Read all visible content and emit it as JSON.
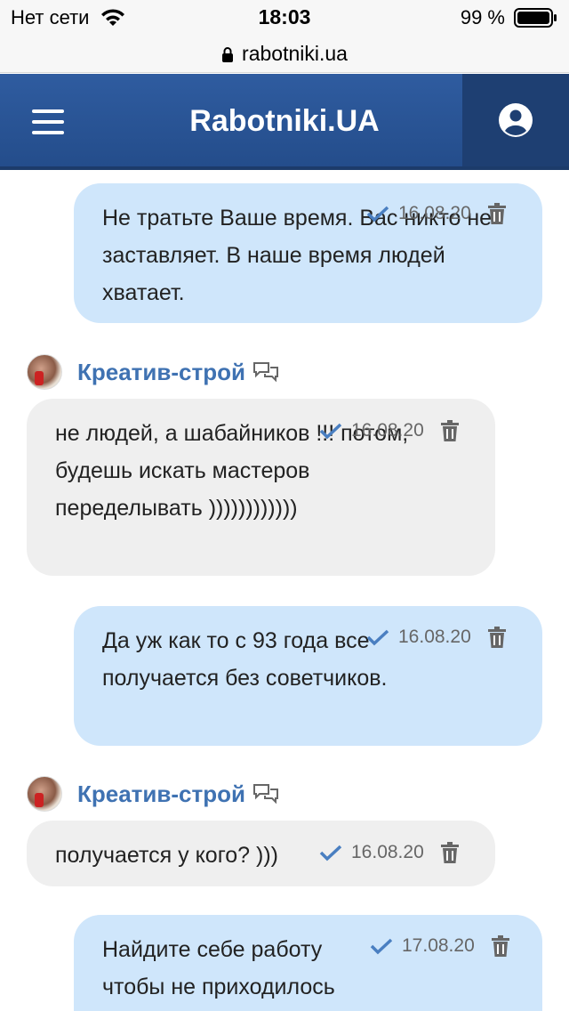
{
  "status_bar": {
    "carrier": "Нет сети",
    "time": "18:03",
    "battery": "99 %"
  },
  "browser": {
    "url": "rabotniki.ua"
  },
  "header": {
    "title": "Rabotniki.UA"
  },
  "colors": {
    "header_bg": "#2f5ca0",
    "my_bubble": "#cfe6fb",
    "their_bubble": "#efefef",
    "author_name": "#3f72b2",
    "check": "#4a7fc1"
  },
  "messages": [
    {
      "side": "mine",
      "text": "Не тратьте Ваше время. Вас никто не заставляет. В наше время людей хватает.",
      "date": "16.08.20"
    },
    {
      "side": "theirs",
      "author": "Креатив-строй",
      "text": "не людей, а шабайников !!! потом, будешь искать мастеров переделывать ))))))))))))",
      "date": "16.08.20"
    },
    {
      "side": "mine",
      "text": "Да уж как то с 93 года все получается без советчиков.",
      "date": "16.08.20"
    },
    {
      "side": "theirs",
      "author": "Креатив-строй",
      "text": "получается у кого? )))",
      "date": "16.08.20"
    },
    {
      "side": "mine",
      "text": "Найдите себе работу чтобы не приходилось",
      "date": "17.08.20"
    }
  ]
}
